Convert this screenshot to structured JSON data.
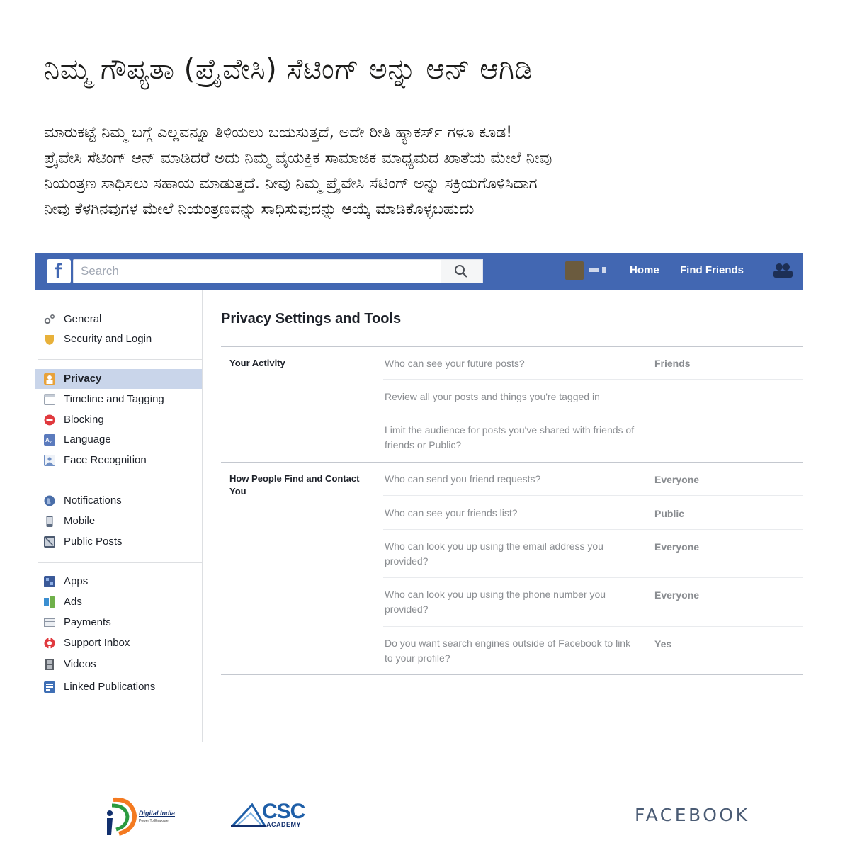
{
  "headline": "ನಿಮ್ಮ ಗೌಪ್ಯತಾ (ಪ್ರೈವೇಸಿ) ಸೆಟಿಂಗ್ ಅನ್ನು ಆನ್ ಆಗಿಡಿ",
  "body_lines": [
    "ಮಾರುಕಟ್ಟೆ ನಿಮ್ಮ ಬಗ್ಗೆ ಎಲ್ಲವನ್ನೂ ತಿಳಿಯಲು ಬಯಸುತ್ತದೆ, ಅದೇ ರೀತಿ ಹ್ಯಾಕರ್ಸ್ ಗಳೂ ಕೂಡ!",
    "ಪ್ರೈವೇಸಿ ಸೆಟಿಂಗ್ ಆನ್ ಮಾಡಿದರೆ ಅದು ನಿಮ್ಮ ವೈಯಕ್ತಿಕ ಸಾಮಾಜಿಕ ಮಾಧ್ಯಮದ ಖಾತೆಯ ಮೇಲೆ ನೀವು",
    "ನಿಯಂತ್ರಣ ಸಾಧಿಸಲು ಸಹಾಯ ಮಾಡುತ್ತದೆ.  ನೀವು ನಿಮ್ಮ ಪ್ರೈವೇಸಿ ಸೆಟಿಂಗ್ ಅನ್ನು ಸಕ್ರಿಯಗೊಳಿಸಿದಾಗ",
    "ನೀವು ಕೆಳಗಿನವುಗಳ ಮೇಲೆ ನಿಯಂತ್ರಣವನ್ನು ಸಾಧಿಸುವುದನ್ನು ಆಯ್ಕೆ ಮಾಡಿಕೊಳ್ಳಬಹುದು"
  ],
  "facebook": {
    "topbar": {
      "logo": "f",
      "search_placeholder": "Search",
      "nav": {
        "home": "Home",
        "find_friends": "Find Friends"
      },
      "color": "#4267b2"
    },
    "sidebar": {
      "groups": [
        [
          {
            "label": "General",
            "icon": "gear-icon",
            "color": "#8a8d91"
          },
          {
            "label": "Security and Login",
            "icon": "shield-icon",
            "color": "#e8b13a"
          }
        ],
        [
          {
            "label": "Privacy",
            "icon": "privacy-lock-icon",
            "color": "#e8a23a",
            "active": true
          },
          {
            "label": "Timeline and Tagging",
            "icon": "timeline-icon",
            "color": "#9aa3b0"
          },
          {
            "label": "Blocking",
            "icon": "block-icon",
            "color": "#e0393e"
          },
          {
            "label": "Language",
            "icon": "language-icon",
            "color": "#5b7bbd"
          },
          {
            "label": "Face Recognition",
            "icon": "face-recognition-icon",
            "color": "#6f8fc4"
          }
        ],
        [
          {
            "label": "Notifications",
            "icon": "globe-icon",
            "color": "#4a6ea9"
          },
          {
            "label": "Mobile",
            "icon": "mobile-icon",
            "color": "#5d6b80"
          },
          {
            "label": "Public Posts",
            "icon": "rss-icon",
            "color": "#4c5a70"
          }
        ],
        [
          {
            "label": "Apps",
            "icon": "apps-icon",
            "color": "#3a5998"
          },
          {
            "label": "Ads",
            "icon": "ads-icon",
            "color": "#3b8fd1"
          },
          {
            "label": "Payments",
            "icon": "card-icon",
            "color": "#8d96a4"
          },
          {
            "label": "Support Inbox",
            "icon": "lifebuoy-icon",
            "color": "#e0393e"
          },
          {
            "label": "Videos",
            "icon": "film-icon",
            "color": "#5a5f66"
          },
          {
            "label": "Linked Publications",
            "icon": "publication-icon",
            "color": "#3f6fb5"
          }
        ]
      ]
    },
    "main": {
      "title": "Privacy Settings and Tools",
      "sections": [
        {
          "title": "Your Activity",
          "rows": [
            {
              "question": "Who can see your future posts?",
              "value": "Friends"
            },
            {
              "question": "Review all your posts and things you're tagged in",
              "value": ""
            },
            {
              "question": "Limit the audience for posts you've shared with friends of friends or Public?",
              "value": ""
            }
          ]
        },
        {
          "title": "How People Find and Contact You",
          "rows": [
            {
              "question": "Who can send you friend requests?",
              "value": "Everyone"
            },
            {
              "question": "Who can see your friends list?",
              "value": "Public"
            },
            {
              "question": "Who can look you up using the email address you provided?",
              "value": "Everyone"
            },
            {
              "question": "Who can look you up using the phone number you provided?",
              "value": "Everyone"
            },
            {
              "question": "Do you want search engines outside of Facebook to link to your profile?",
              "value": "Yes"
            }
          ]
        }
      ]
    }
  },
  "footer": {
    "digital_india": {
      "name": "Digital India",
      "tagline": "Power To Empower"
    },
    "csc": {
      "name": "CSC",
      "sub": "ACADEMY"
    },
    "brand": "FACEBOOK"
  }
}
